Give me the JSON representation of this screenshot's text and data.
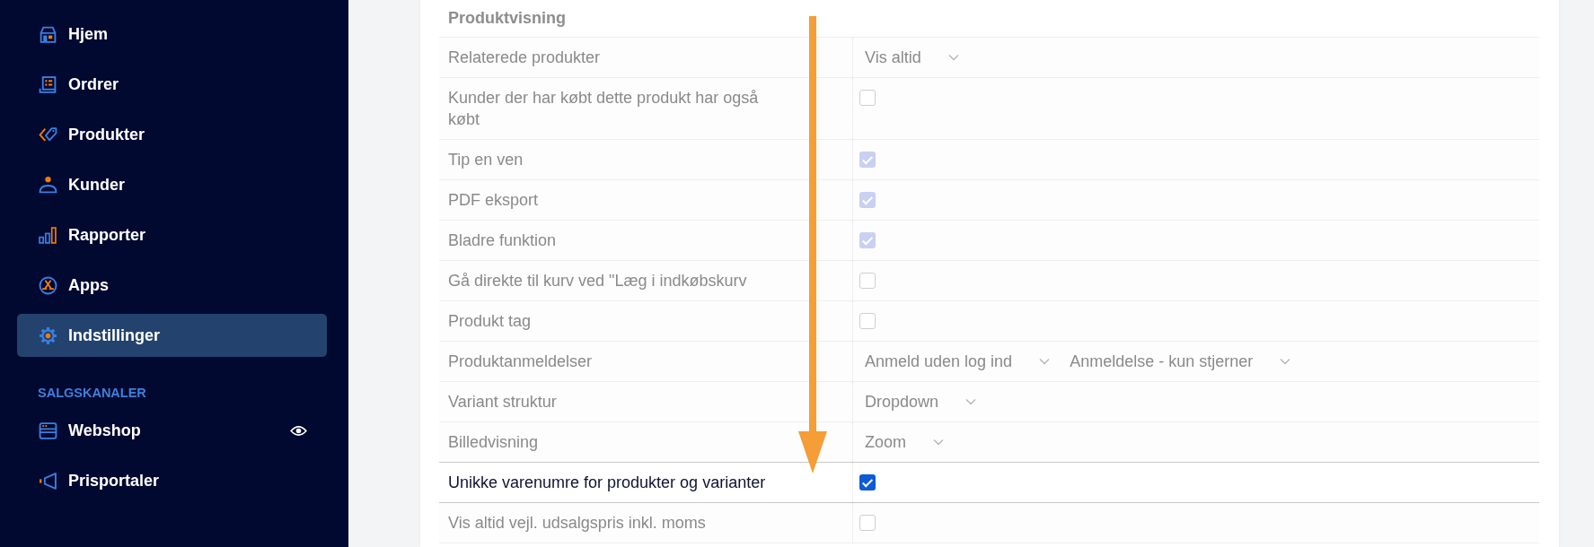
{
  "sidebar": {
    "items": [
      {
        "label": "Hjem",
        "kind": "home",
        "selected": false
      },
      {
        "label": "Ordrer",
        "kind": "orders",
        "selected": false
      },
      {
        "label": "Produkter",
        "kind": "products",
        "selected": false
      },
      {
        "label": "Kunder",
        "kind": "customers",
        "selected": false
      },
      {
        "label": "Rapporter",
        "kind": "reports",
        "selected": false
      },
      {
        "label": "Apps",
        "kind": "apps",
        "selected": false
      },
      {
        "label": "Indstillinger",
        "kind": "settings",
        "selected": true
      }
    ],
    "channels": {
      "heading": "SALGSKANALER",
      "items": [
        {
          "label": "Webshop",
          "kind": "webshop",
          "selected": false,
          "viewable": true
        },
        {
          "label": "Prisportaler",
          "kind": "price_portals",
          "selected": false,
          "viewable": false
        }
      ]
    }
  },
  "settings": {
    "title": "Produktvisning",
    "disabled": true,
    "rows": [
      {
        "label": "Relaterede produkter",
        "kind": "select",
        "disabled": true,
        "values": [
          "Vis altid"
        ]
      },
      {
        "label": "Kunder der har købt dette produkt har også købt",
        "kind": "checkbox",
        "disabled": true,
        "checked": false
      },
      {
        "label": "Tip en ven",
        "kind": "checkbox",
        "disabled": true,
        "checked": true
      },
      {
        "label": "PDF eksport",
        "kind": "checkbox",
        "disabled": true,
        "checked": true
      },
      {
        "label": "Bladre funktion",
        "kind": "checkbox",
        "disabled": true,
        "checked": true
      },
      {
        "label": "Gå direkte til kurv ved \"Læg i indkøbskurv",
        "kind": "checkbox",
        "disabled": true,
        "checked": false
      },
      {
        "label": "Produkt tag",
        "kind": "checkbox",
        "disabled": true,
        "checked": false
      },
      {
        "label": "Produktanmeldelser",
        "kind": "select",
        "disabled": true,
        "values": [
          "Anmeld uden log ind",
          "Anmeldelse - kun stjerner"
        ]
      },
      {
        "label": "Variant struktur",
        "kind": "select",
        "disabled": true,
        "values": [
          "Dropdown"
        ]
      },
      {
        "label": "Billedvisning",
        "kind": "select",
        "disabled": true,
        "values": [
          "Zoom"
        ]
      },
      {
        "label": "Unikke varenumre for produkter og varianter",
        "kind": "checkbox",
        "disabled": false,
        "checked": true
      },
      {
        "label": "Vis altid vejl. udsalgspris inkl. moms",
        "kind": "checkbox",
        "disabled": true,
        "checked": false
      }
    ]
  }
}
